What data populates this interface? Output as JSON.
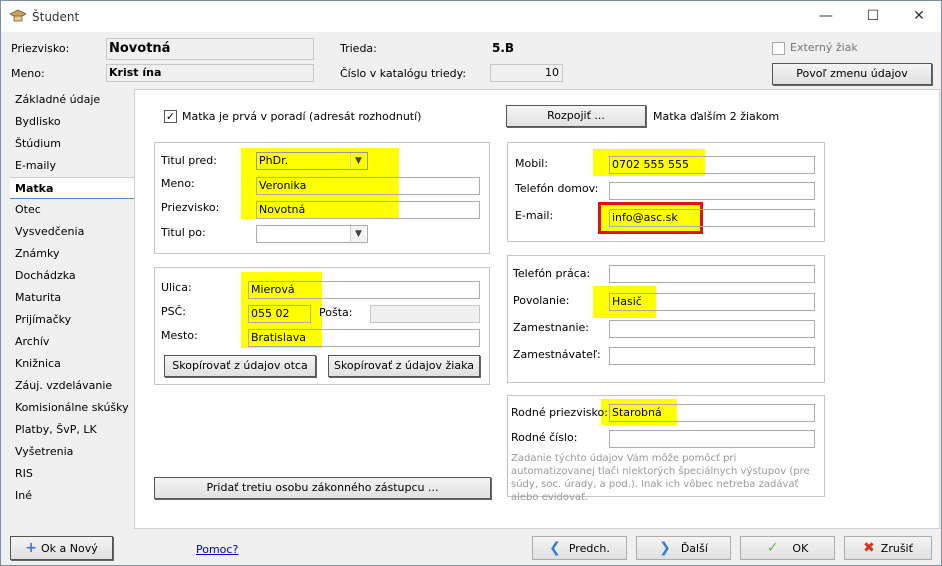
{
  "window": {
    "title": "Študent"
  },
  "header": {
    "priezvisko_label": "Priezvisko:",
    "priezvisko_value": "Novotná",
    "meno_label": "Meno:",
    "meno_value": "Krist ína",
    "trieda_label": "Trieda:",
    "trieda_value": "5.B",
    "cislo_label": "Číslo v katalógu triedy:",
    "cislo_value": "10",
    "externy_label": "Externý žiak",
    "povol_button": "Povoľ zmenu údajov"
  },
  "sidebar": {
    "items": [
      {
        "label": "Základné údaje"
      },
      {
        "label": "Bydlisko"
      },
      {
        "label": "Štúdium"
      },
      {
        "label": "E-maily"
      },
      {
        "label": "Matka"
      },
      {
        "label": "Otec"
      },
      {
        "label": "Vysvedčenia"
      },
      {
        "label": "Známky"
      },
      {
        "label": "Dochádzka"
      },
      {
        "label": "Maturita"
      },
      {
        "label": "Prijímačky"
      },
      {
        "label": "Archív"
      },
      {
        "label": "Knižnica"
      },
      {
        "label": "Záuj. vzdelávanie"
      },
      {
        "label": "Komisionálne skúšky"
      },
      {
        "label": "Platby, ŠvP, LK"
      },
      {
        "label": "Vyšetrenia"
      },
      {
        "label": "RIS"
      },
      {
        "label": "Iné"
      }
    ],
    "active": "Matka"
  },
  "main": {
    "prva_label": "Matka je prvá v poradí (adresát rozhodnutí)",
    "rozpojit_button": "Rozpojiť ...",
    "rozpojit_note": "Matka ďalším 2 žiakom",
    "titul_pred_label": "Titul pred:",
    "titul_pred_value": "PhDr.",
    "meno_label": "Meno:",
    "meno_value": "Veronika",
    "priezvisko_label": "Priezvisko:",
    "priezvisko_value": "Novotná",
    "titul_po_label": "Titul po:",
    "titul_po_value": "",
    "ulica_label": "Ulica:",
    "ulica_value": "Mierová",
    "psc_label": "PSČ:",
    "psc_value": "055 02",
    "posta_label": "Pošta:",
    "posta_value": "",
    "mesto_label": "Mesto:",
    "mesto_value": "Bratislava",
    "kopirovat_otca": "Skopírovať z údajov otca",
    "kopirovat_ziaka": "Skopírovať z údajov žiaka",
    "pridat_tretiu": "Pridať tretiu osobu zákonného zástupcu ...",
    "mobil_label": "Mobil:",
    "mobil_value": "0702 555 555",
    "telefon_domov_label": "Telefón domov:",
    "telefon_domov_value": "",
    "email_label": "E-mail:",
    "email_value": "info@asc.sk",
    "telefon_praca_label": "Telefón práca:",
    "telefon_praca_value": "",
    "povolanie_label": "Povolanie:",
    "povolanie_value": "Hasič",
    "zamestnanie_label": "Zamestnanie:",
    "zamestnanie_value": "",
    "zamestnavatel_label": "Zamestnávateľ:",
    "zamestnavatel_value": "",
    "rodne_priezvisko_label": "Rodné priezvisko:",
    "rodne_priezvisko_value": "Starobná",
    "rodne_cislo_label": "Rodné číslo:",
    "rodne_cislo_value": "",
    "note": "Zadanie týchto údajov Vám môže pomôcť pri automatizovanej tlači niektorých špeciálnych výstupov (pre súdy, soc. úrady, a pod.). Inak ich vôbec netreba zadávať alebo evidovať."
  },
  "footer": {
    "ok_novy": "Ok a Nový",
    "pomoc": "Pomoc?",
    "predch": "Predch.",
    "dalsi": "Ďalší",
    "ok": "OK",
    "zrusit": "Zrušiť"
  },
  "colors": {
    "highlight": "#ffff00",
    "email_border": "#e01010",
    "link": "#0000cc"
  }
}
